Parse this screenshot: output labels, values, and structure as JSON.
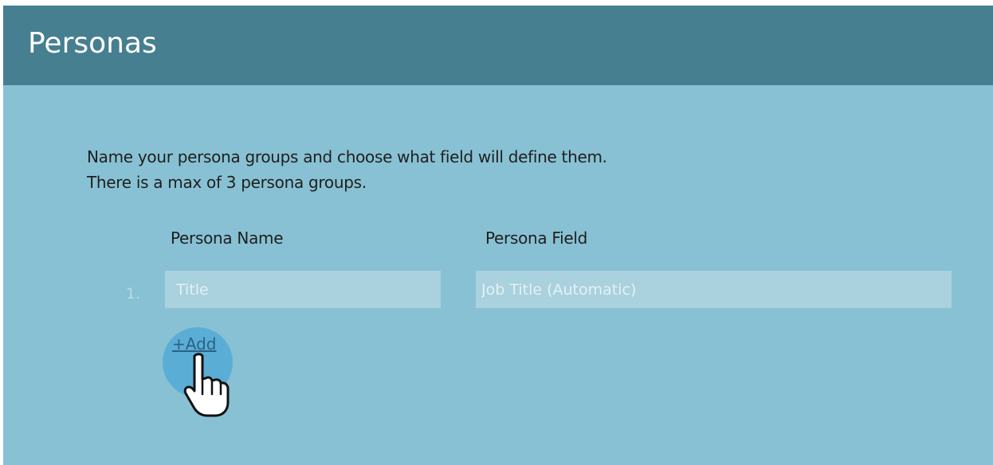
{
  "header": {
    "title": "Personas"
  },
  "instructions": {
    "line1": "Name your persona groups and choose what field will define them.",
    "line2": "There is a max of 3 persona groups."
  },
  "table": {
    "columns": {
      "name": "Persona Name",
      "field": "Persona Field"
    },
    "rows": [
      {
        "number": "1.",
        "name_placeholder": "Title",
        "name_value": "",
        "field_placeholder": "Job Title (Automatic)",
        "field_value": ""
      }
    ]
  },
  "actions": {
    "add_label": "+Add"
  },
  "colors": {
    "header_bg": "#457f90",
    "panel_bg": "#88c1d3",
    "input_bg": "#a9d1de",
    "link": "#2c5f86",
    "click_highlight": "#5aaed6"
  },
  "cursor": {
    "icon": "hand-pointer-icon"
  }
}
